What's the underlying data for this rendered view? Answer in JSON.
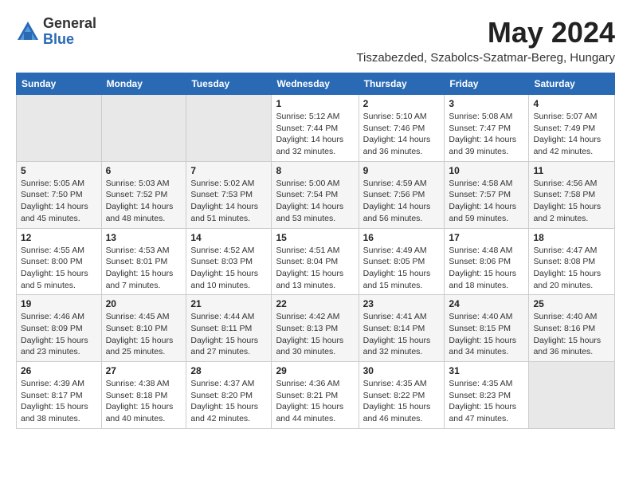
{
  "logo": {
    "general": "General",
    "blue": "Blue"
  },
  "title": "May 2024",
  "location": "Tiszabezded, Szabolcs-Szatmar-Bereg, Hungary",
  "days_of_week": [
    "Sunday",
    "Monday",
    "Tuesday",
    "Wednesday",
    "Thursday",
    "Friday",
    "Saturday"
  ],
  "weeks": [
    [
      {
        "day": "",
        "info": ""
      },
      {
        "day": "",
        "info": ""
      },
      {
        "day": "",
        "info": ""
      },
      {
        "day": "1",
        "info": "Sunrise: 5:12 AM\nSunset: 7:44 PM\nDaylight: 14 hours\nand 32 minutes."
      },
      {
        "day": "2",
        "info": "Sunrise: 5:10 AM\nSunset: 7:46 PM\nDaylight: 14 hours\nand 36 minutes."
      },
      {
        "day": "3",
        "info": "Sunrise: 5:08 AM\nSunset: 7:47 PM\nDaylight: 14 hours\nand 39 minutes."
      },
      {
        "day": "4",
        "info": "Sunrise: 5:07 AM\nSunset: 7:49 PM\nDaylight: 14 hours\nand 42 minutes."
      }
    ],
    [
      {
        "day": "5",
        "info": "Sunrise: 5:05 AM\nSunset: 7:50 PM\nDaylight: 14 hours\nand 45 minutes."
      },
      {
        "day": "6",
        "info": "Sunrise: 5:03 AM\nSunset: 7:52 PM\nDaylight: 14 hours\nand 48 minutes."
      },
      {
        "day": "7",
        "info": "Sunrise: 5:02 AM\nSunset: 7:53 PM\nDaylight: 14 hours\nand 51 minutes."
      },
      {
        "day": "8",
        "info": "Sunrise: 5:00 AM\nSunset: 7:54 PM\nDaylight: 14 hours\nand 53 minutes."
      },
      {
        "day": "9",
        "info": "Sunrise: 4:59 AM\nSunset: 7:56 PM\nDaylight: 14 hours\nand 56 minutes."
      },
      {
        "day": "10",
        "info": "Sunrise: 4:58 AM\nSunset: 7:57 PM\nDaylight: 14 hours\nand 59 minutes."
      },
      {
        "day": "11",
        "info": "Sunrise: 4:56 AM\nSunset: 7:58 PM\nDaylight: 15 hours\nand 2 minutes."
      }
    ],
    [
      {
        "day": "12",
        "info": "Sunrise: 4:55 AM\nSunset: 8:00 PM\nDaylight: 15 hours\nand 5 minutes."
      },
      {
        "day": "13",
        "info": "Sunrise: 4:53 AM\nSunset: 8:01 PM\nDaylight: 15 hours\nand 7 minutes."
      },
      {
        "day": "14",
        "info": "Sunrise: 4:52 AM\nSunset: 8:03 PM\nDaylight: 15 hours\nand 10 minutes."
      },
      {
        "day": "15",
        "info": "Sunrise: 4:51 AM\nSunset: 8:04 PM\nDaylight: 15 hours\nand 13 minutes."
      },
      {
        "day": "16",
        "info": "Sunrise: 4:49 AM\nSunset: 8:05 PM\nDaylight: 15 hours\nand 15 minutes."
      },
      {
        "day": "17",
        "info": "Sunrise: 4:48 AM\nSunset: 8:06 PM\nDaylight: 15 hours\nand 18 minutes."
      },
      {
        "day": "18",
        "info": "Sunrise: 4:47 AM\nSunset: 8:08 PM\nDaylight: 15 hours\nand 20 minutes."
      }
    ],
    [
      {
        "day": "19",
        "info": "Sunrise: 4:46 AM\nSunset: 8:09 PM\nDaylight: 15 hours\nand 23 minutes."
      },
      {
        "day": "20",
        "info": "Sunrise: 4:45 AM\nSunset: 8:10 PM\nDaylight: 15 hours\nand 25 minutes."
      },
      {
        "day": "21",
        "info": "Sunrise: 4:44 AM\nSunset: 8:11 PM\nDaylight: 15 hours\nand 27 minutes."
      },
      {
        "day": "22",
        "info": "Sunrise: 4:42 AM\nSunset: 8:13 PM\nDaylight: 15 hours\nand 30 minutes."
      },
      {
        "day": "23",
        "info": "Sunrise: 4:41 AM\nSunset: 8:14 PM\nDaylight: 15 hours\nand 32 minutes."
      },
      {
        "day": "24",
        "info": "Sunrise: 4:40 AM\nSunset: 8:15 PM\nDaylight: 15 hours\nand 34 minutes."
      },
      {
        "day": "25",
        "info": "Sunrise: 4:40 AM\nSunset: 8:16 PM\nDaylight: 15 hours\nand 36 minutes."
      }
    ],
    [
      {
        "day": "26",
        "info": "Sunrise: 4:39 AM\nSunset: 8:17 PM\nDaylight: 15 hours\nand 38 minutes."
      },
      {
        "day": "27",
        "info": "Sunrise: 4:38 AM\nSunset: 8:18 PM\nDaylight: 15 hours\nand 40 minutes."
      },
      {
        "day": "28",
        "info": "Sunrise: 4:37 AM\nSunset: 8:20 PM\nDaylight: 15 hours\nand 42 minutes."
      },
      {
        "day": "29",
        "info": "Sunrise: 4:36 AM\nSunset: 8:21 PM\nDaylight: 15 hours\nand 44 minutes."
      },
      {
        "day": "30",
        "info": "Sunrise: 4:35 AM\nSunset: 8:22 PM\nDaylight: 15 hours\nand 46 minutes."
      },
      {
        "day": "31",
        "info": "Sunrise: 4:35 AM\nSunset: 8:23 PM\nDaylight: 15 hours\nand 47 minutes."
      },
      {
        "day": "",
        "info": ""
      }
    ]
  ]
}
